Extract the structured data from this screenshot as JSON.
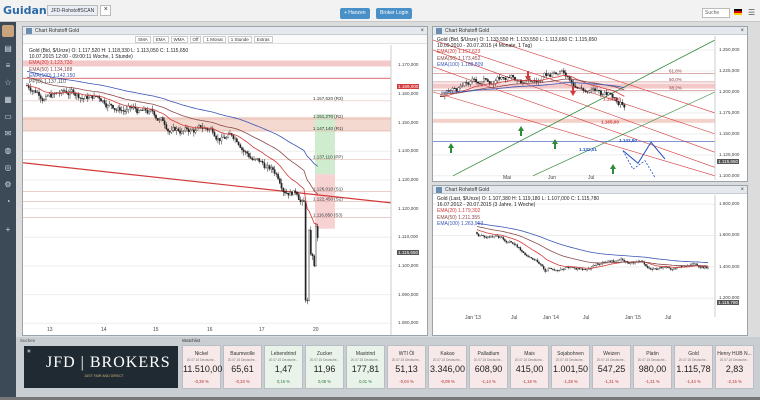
{
  "app": {
    "logo": "Guidants",
    "tabs": [
      {
        "label": "JFD-RohstoffSCAN"
      },
      {
        "label": "×"
      }
    ],
    "buttons": {
      "premium": "+ Hanzen",
      "login": "Broker Login"
    },
    "search_placeholder": "Suche",
    "colors": {
      "accent": "#4a90c8",
      "sidebar": "#3c4a57",
      "red": "#d43a3a",
      "green": "#2f8a3a"
    }
  },
  "main_chart": {
    "title": "Chart Rohstoff Gold",
    "toolbar": [
      "SMA",
      "EMA",
      "WMA",
      "Off",
      "1 Monat",
      "1 Stunde",
      "Extras"
    ],
    "legend": [
      {
        "text": "Gold (Bid, $/Unze)  O: 1.117,520  H: 1.118,330  L: 1.113,050  C: 1.115,650",
        "color": "#222"
      },
      {
        "text": "10.07.2015 12:00 - 09:00:11 Woche, 1 Stunde)",
        "color": "#222"
      },
      {
        "text": "EMA(20)   1.123,730",
        "color": "#d43a3a"
      },
      {
        "text": "EMA(50)   1.134,188",
        "color": "#8b4a4a"
      },
      {
        "text": "EMA(100)  1.142,150",
        "color": "#3b56b5"
      },
      {
        "text": "PP(D)   1.137,110",
        "color": "#444"
      }
    ],
    "yticks": [
      "1.170,000",
      "1.160,000",
      "1.150,000",
      "1.140,000",
      "1.130,000",
      "1.120,000",
      "1.110,000",
      "1.100,000",
      "1.090,000",
      "1.080,000"
    ],
    "xticks": [
      "13",
      "14",
      "15",
      "16",
      "17",
      "20"
    ],
    "levels": [
      "1.157,620 (R3)",
      "1.151,270 (R2)",
      "1.147,140 (R1)",
      "1.137,110 (PP)",
      "1.126,010 (S1)",
      "1.122,450 (S2)",
      "1.116,850 (S3)"
    ],
    "price_tags": {
      "top": "1.169,000",
      "last": "1.115,650"
    }
  },
  "tr_chart": {
    "title": "Chart Rohstoff Gold",
    "legend": [
      {
        "text": "Gold (Bid, $/Unze)  O: 1.133,550  H: 1.133,550  L: 1.113,650  C: 1.115,650",
        "color": "#222"
      },
      {
        "text": "10.09.2010 - 20.07.2015 (4 Monate, 1 Tag)",
        "color": "#222"
      },
      {
        "text": "EMA(20)   1.157,623",
        "color": "#d43a3a"
      },
      {
        "text": "EMA(50)   1.173,452",
        "color": "#8b4a4a"
      },
      {
        "text": "EMA(100)  1.188,809",
        "color": "#3b56b5"
      }
    ],
    "yticks": [
      "1.250,000",
      "1.225,000",
      "1.200,000",
      "1.175,000",
      "1.150,000",
      "1.125,000",
      "1.100,000"
    ],
    "xticks": [
      "Mai",
      "Jun",
      "Jul"
    ],
    "fib": [
      "61,8%",
      "50,0%",
      "38,2%"
    ],
    "marks": [
      "1.192,00",
      "1.165,00",
      "1.142,50",
      "1.132,01"
    ],
    "price_tags": {
      "last": "1.115,650"
    }
  },
  "br_chart": {
    "title": "Chart Rohstoff Gold",
    "legend": [
      {
        "text": "Gold (Last, $/Unze)  O: 1.107,380  H: 1.119,180  L: 1.107,000  C: 1.115,780",
        "color": "#222"
      },
      {
        "text": "16.07.2012 - 20.07.2015 (3 Jahre, 1 Woche)",
        "color": "#222"
      },
      {
        "text": "EMA(20)   1.179,302",
        "color": "#d43a3a"
      },
      {
        "text": "EMA(50)   1.211,355",
        "color": "#8b4a4a"
      },
      {
        "text": "EMA(100)  1.263,963",
        "color": "#3b56b5"
      }
    ],
    "yticks": [
      "1.800,000",
      "1.600,000",
      "1.400,000",
      "1.200,000"
    ],
    "xticks": [
      "Jan '13",
      "Jul",
      "Jan '14",
      "Jul",
      "Jan '15",
      "Jul"
    ],
    "price_tags": {
      "last": "1.115,780"
    }
  },
  "bottom": {
    "left_label": "Suchen",
    "watchlist_label": "Watchlist",
    "ad": {
      "brand": "JFD | BROKERS",
      "slogan": "JUST FAIR AND DIRECT"
    },
    "tiles": [
      {
        "name": "Nickel",
        "time": "20.07.15 Deutsche...",
        "value": "11.510,00",
        "change": "-0,39 %",
        "trend": "neg"
      },
      {
        "name": "Baumwolle",
        "time": "20.07.15 Deutsche...",
        "value": "65,61",
        "change": "-0,33 %",
        "trend": "neg"
      },
      {
        "name": "Lebendrind",
        "time": "20.07.15 Deutsche...",
        "value": "1,47",
        "change": "0,15 %",
        "trend": "pos"
      },
      {
        "name": "Zucker",
        "time": "20.07.15 Deutsche...",
        "value": "11,96",
        "change": "0,08 %",
        "trend": "pos"
      },
      {
        "name": "Mastrind",
        "time": "20.07.15 Deutsche...",
        "value": "177,81",
        "change": "0,01 %",
        "trend": "pos"
      },
      {
        "name": "WTI Öl",
        "time": "20.07.15 Deutsche...",
        "value": "51,13",
        "change": "-0,04 %",
        "trend": "neg"
      },
      {
        "name": "Kakao",
        "time": "20.07.15 Deutsche...",
        "value": "3.346,00",
        "change": "-0,09 %",
        "trend": "neg"
      },
      {
        "name": "Palladium",
        "time": "20.07.15 Deutsche...",
        "value": "608,90",
        "change": "-1,14 %",
        "trend": "neg"
      },
      {
        "name": "Mais",
        "time": "20.07.15 Deutsche...",
        "value": "415,00",
        "change": "-1,19 %",
        "trend": "neg"
      },
      {
        "name": "Sojabohnen",
        "time": "20.07.15 Deutsche...",
        "value": "1.001,50",
        "change": "-1,28 %",
        "trend": "neg"
      },
      {
        "name": "Weizen",
        "time": "20.07.15 Deutsche...",
        "value": "547,25",
        "change": "-1,31 %",
        "trend": "neg"
      },
      {
        "name": "Platin",
        "time": "20.07.15 Deutsche...",
        "value": "980,00",
        "change": "-1,31 %",
        "trend": "neg"
      },
      {
        "name": "Gold",
        "time": "20.07.15 Deutsche...",
        "value": "1.115,78",
        "change": "-1,44 %",
        "trend": "neg"
      },
      {
        "name": "Henry HUB N...",
        "time": "20.07.15 Deutsche...",
        "value": "2,83",
        "change": "-2,15 %",
        "trend": "neg"
      }
    ]
  }
}
